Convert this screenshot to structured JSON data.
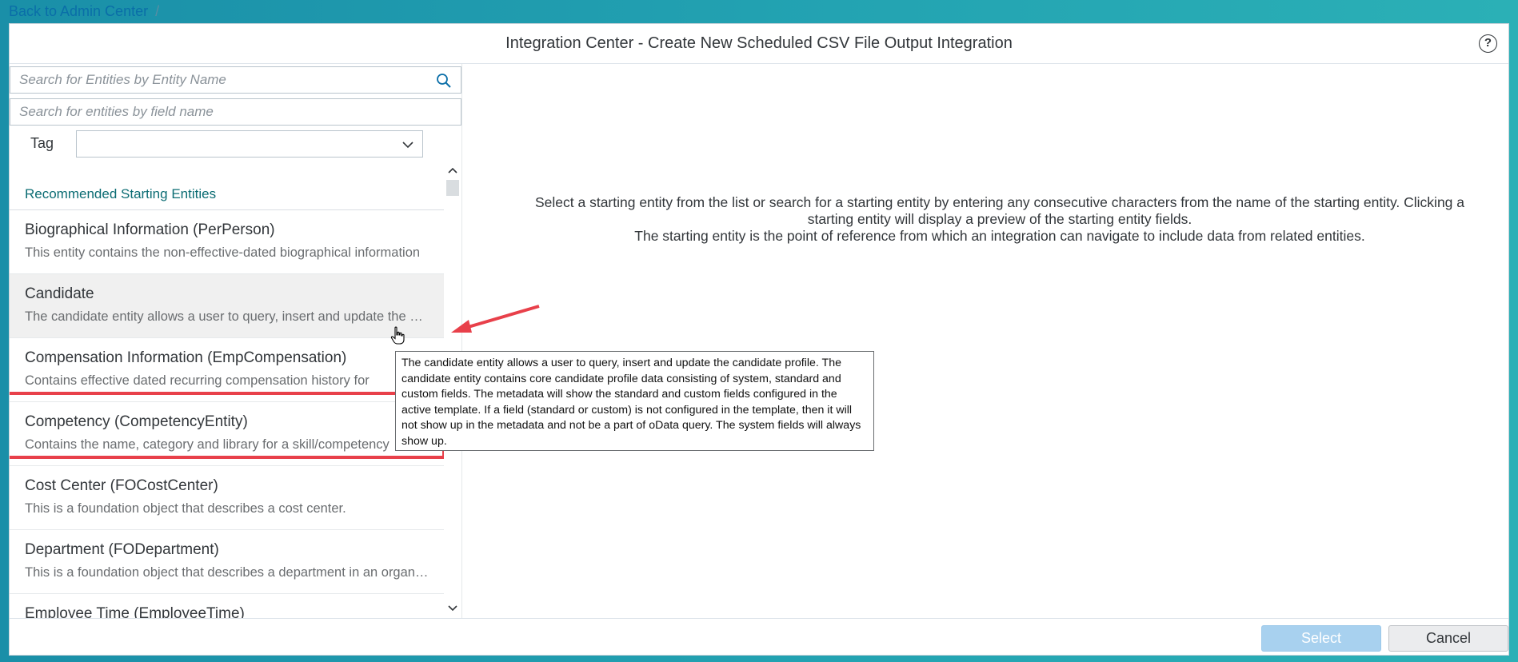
{
  "top_bar": {
    "back_link": "Back to Admin Center",
    "separator": "/"
  },
  "dialog": {
    "title": "Integration Center - Create New Scheduled CSV File Output Integration",
    "help_icon": "question-circle-icon",
    "help_glyph": "?"
  },
  "filters": {
    "entity_search_placeholder": "Search for Entities by Entity Name",
    "field_search_placeholder": "Search for entities by field name",
    "tag_label": "Tag",
    "tag_value": ""
  },
  "list": {
    "group_header": "Recommended Starting Entities",
    "items": [
      {
        "title": "Biographical Information (PerPerson)",
        "desc": "This entity contains the non-effective-dated biographical information"
      },
      {
        "title": "Candidate",
        "desc": "The candidate entity allows a user to query, insert and update the candidate profile"
      },
      {
        "title": "Compensation Information (EmpCompensation)",
        "desc": "Contains effective dated recurring compensation history for"
      },
      {
        "title": "Competency (CompetencyEntity)",
        "desc": "Contains the name, category and library for a skill/competency"
      },
      {
        "title": "Cost Center (FOCostCenter)",
        "desc": "This is a foundation object that describes a cost center."
      },
      {
        "title": "Department (FODepartment)",
        "desc": "This is a foundation object that describes a department in an organization"
      },
      {
        "title": "Employee Time (EmployeeTime)",
        "desc": ""
      }
    ]
  },
  "right_panel": {
    "instructions_line1": "Select a starting entity from the list or search for a starting entity by entering any consecutive characters from the name of the starting entity. Clicking a starting entity will display a preview of the starting entity fields.",
    "instructions_line2": "The starting entity is the point of reference from which an integration can navigate to include data from related entities."
  },
  "tooltip": {
    "text": "The candidate entity allows a user to query, insert and update the candidate profile. The candidate entity contains core candidate profile data consisting of system, standard and custom fields. The metadata will show the standard and custom fields configured in the active template. If a field (standard or custom) is not configured in the template, then it will not show up in the metadata and not be a part of oData query. The system fields will always show up."
  },
  "footer": {
    "select_label": "Select",
    "cancel_label": "Cancel"
  },
  "colors": {
    "accent": "#0b6c73",
    "link": "#0a6ea8",
    "highlight": "#e8404a",
    "select_button": "#a8d1ef"
  }
}
